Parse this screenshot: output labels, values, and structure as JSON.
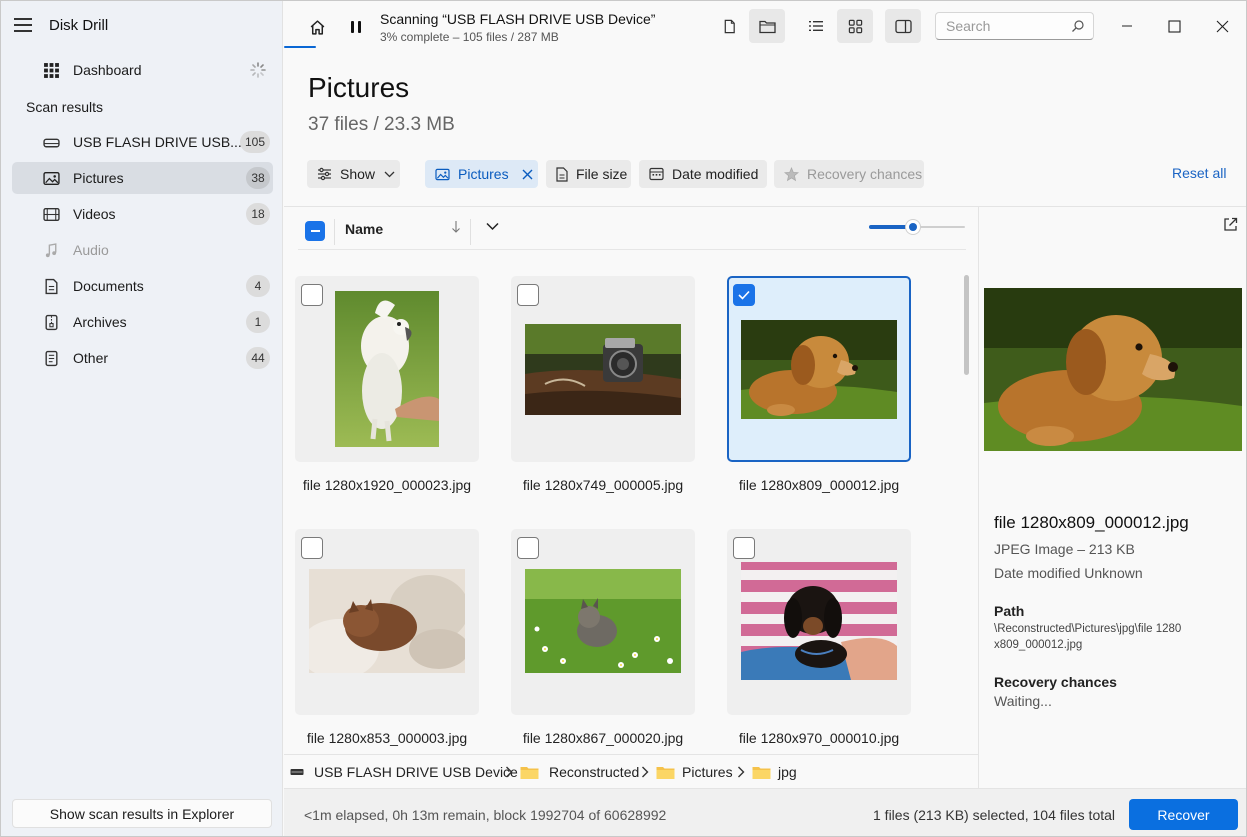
{
  "app": {
    "title": "Disk Drill"
  },
  "sidebar": {
    "dashboard_label": "Dashboard",
    "section_label": "Scan results",
    "items": [
      {
        "label": "USB FLASH DRIVE USB...",
        "count": "105",
        "icon": "drive-icon"
      },
      {
        "label": "Pictures",
        "count": "38",
        "icon": "picture-icon",
        "active": true
      },
      {
        "label": "Videos",
        "count": "18",
        "icon": "film-icon"
      },
      {
        "label": "Audio",
        "count": "",
        "icon": "music-icon"
      },
      {
        "label": "Documents",
        "count": "4",
        "icon": "document-icon"
      },
      {
        "label": "Archives",
        "count": "1",
        "icon": "archive-icon"
      },
      {
        "label": "Other",
        "count": "44",
        "icon": "other-file-icon"
      }
    ],
    "footer_button": "Show scan results in Explorer"
  },
  "topbar": {
    "scan_title": "Scanning “USB FLASH DRIVE USB Device”",
    "scan_subtitle": "3% complete – 105 files / 287 MB",
    "search_placeholder": "Search"
  },
  "content": {
    "title": "Pictures",
    "subtitle": "37 files / 23.3 MB",
    "filters": {
      "show": "Show",
      "pictures": "Pictures",
      "file_size": "File size",
      "date_modified": "Date modified",
      "recovery_chances": "Recovery chances"
    },
    "reset_all": "Reset all",
    "column_name": "Name",
    "thumbnail_size_level": 0.45
  },
  "files": [
    {
      "caption": "file 1280x1920_000023.jpg",
      "checked": false,
      "subject": "white cockatoo"
    },
    {
      "caption": "file 1280x749_000005.jpg",
      "checked": false,
      "subject": "vintage camera"
    },
    {
      "caption": "file 1280x809_000012.jpg",
      "checked": true,
      "subject": "golden retriever puppy"
    },
    {
      "caption": "file 1280x853_000003.jpg",
      "checked": false,
      "subject": "sleeping kittens"
    },
    {
      "caption": "file 1280x867_000020.jpg",
      "checked": false,
      "subject": "kitten in grass"
    },
    {
      "caption": "file 1280x970_000010.jpg",
      "checked": false,
      "subject": "dachshund puppy"
    }
  ],
  "breadcrumb": {
    "device": "USB FLASH DRIVE USB Device",
    "folders": [
      "Reconstructed",
      "Pictures",
      "jpg"
    ]
  },
  "preview": {
    "file_name": "file 1280x809_000012.jpg",
    "type_size": "JPEG Image – 213 KB",
    "date_modified": "Date modified Unknown",
    "path_label": "Path",
    "path_value": "\\Reconstructed\\Pictures\\jpg\\file 1280x809_000012.jpg",
    "recovery_label": "Recovery chances",
    "recovery_value": "Waiting..."
  },
  "status": {
    "progress_text": "<1m elapsed, 0h 13m remain, block 1992704 of 60628992",
    "selection_text": "1 files (213 KB) selected, 104 files total",
    "recover_button": "Recover"
  },
  "colors": {
    "accent": "#0a6fe0",
    "link": "#1a64c4",
    "selected_tile": "#deeefb"
  }
}
